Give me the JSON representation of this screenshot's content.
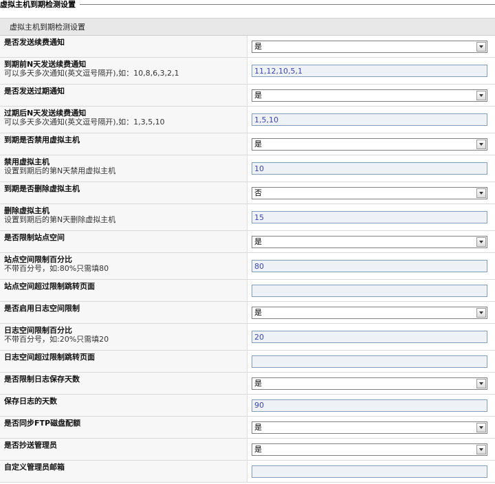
{
  "page_title": "虚拟主机到期检测设置",
  "section_title": "虚拟主机到期检测设置",
  "rows": [
    {
      "label": "是否发送续费通知",
      "hint": "",
      "type": "select",
      "value": "是"
    },
    {
      "label": "到期前N天发送续费通知",
      "hint": "可以多天多次通知(英文逗号隔开),如：10,8,6,3,2,1",
      "type": "input",
      "value": "11,12,10,5,1"
    },
    {
      "label": "是否发送过期通知",
      "hint": "",
      "type": "select",
      "value": "是"
    },
    {
      "label": "过期后N天发送续费通知",
      "hint": "可以多天多次通知(英文逗号隔开),如：1,3,5,10",
      "type": "input",
      "value": "1,5,10"
    },
    {
      "label": "到期是否禁用虚拟主机",
      "hint": "",
      "type": "select",
      "value": "是"
    },
    {
      "label": "禁用虚拟主机",
      "hint": "设置到期后的第N天禁用虚拟主机",
      "type": "input",
      "value": "10"
    },
    {
      "label": "到期是否删除虚拟主机",
      "hint": "",
      "type": "select",
      "value": "否"
    },
    {
      "label": "删除虚拟主机",
      "hint": "设置到期后的第N天删除虚拟主机",
      "type": "input",
      "value": "15"
    },
    {
      "label": "是否限制站点空间",
      "hint": "",
      "type": "select",
      "value": "是"
    },
    {
      "label": "站点空间限制百分比",
      "hint": "不带百分号，如:80%只需填80",
      "type": "input",
      "value": "80"
    },
    {
      "label": "站点空间超过限制跳转页面",
      "hint": "",
      "type": "input",
      "value": ""
    },
    {
      "label": "是否启用日志空间限制",
      "hint": "",
      "type": "select",
      "value": "是"
    },
    {
      "label": "日志空间限制百分比",
      "hint": "不带百分号，如:20%只需填20",
      "type": "input",
      "value": "20"
    },
    {
      "label": "日志空间超过限制跳转页面",
      "hint": "",
      "type": "input",
      "value": ""
    },
    {
      "label": "是否限制日志保存天数",
      "hint": "",
      "type": "select",
      "value": "是"
    },
    {
      "label": "保存日志的天数",
      "hint": "",
      "type": "input",
      "value": "90"
    },
    {
      "label": "是否同步FTP磁盘配额",
      "hint": "",
      "type": "select",
      "value": "是"
    },
    {
      "label": "是否抄送管理员",
      "hint": "",
      "type": "select",
      "value": "是"
    },
    {
      "label": "自定义管理员邮箱",
      "hint": "",
      "type": "input",
      "value": ""
    }
  ]
}
